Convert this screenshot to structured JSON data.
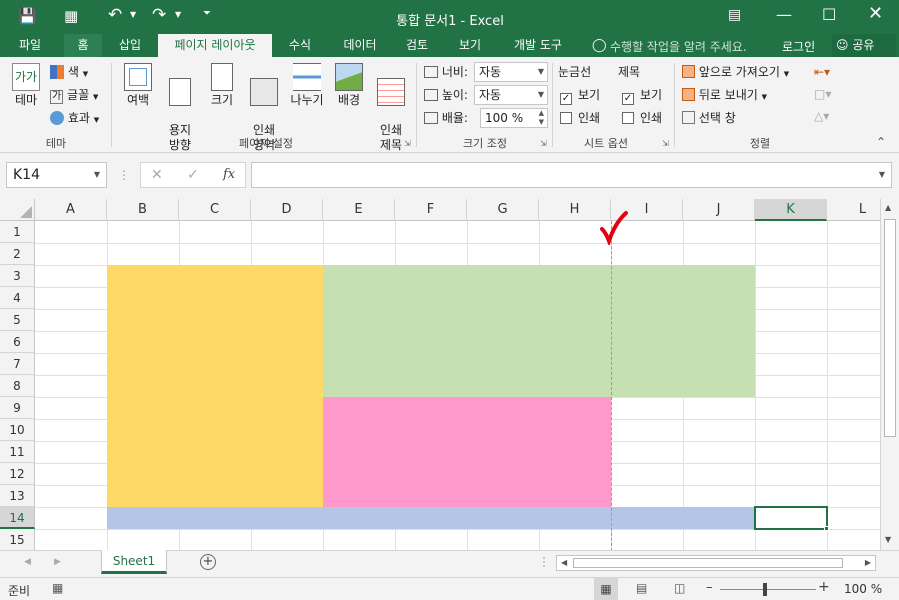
{
  "window": {
    "title": "통합 문서1 - Excel"
  },
  "tabs": [
    "파일",
    "홈",
    "삽입",
    "페이지 레이아웃",
    "수식",
    "데이터",
    "검토",
    "보기",
    "개발 도구"
  ],
  "active_tab": "페이지 레이아웃",
  "tell_me": "수행할 작업을 알려 주세요.",
  "account": {
    "login": "로그인",
    "share": "공유"
  },
  "ribbon": {
    "theme": {
      "label": "테마",
      "colors": "색",
      "fonts": "글꼴",
      "effects": "효과",
      "group": "테마"
    },
    "page_setup": {
      "margins": "여백",
      "orientation": "용지\n방향",
      "size": "크기",
      "print_area": "인쇄\n영역",
      "breaks": "나누기",
      "background": "배경",
      "print_titles": "인쇄\n제목",
      "group": "페이지 설정"
    },
    "scale": {
      "width_label": "너비:",
      "width_value": "자동",
      "height_label": "높이:",
      "height_value": "자동",
      "scale_label": "배율:",
      "scale_value": "100 %",
      "group": "크기 조정"
    },
    "sheet_options": {
      "gridlines": "눈금선",
      "headings": "제목",
      "view": "보기",
      "print": "인쇄",
      "group": "시트 옵션"
    },
    "arrange": {
      "bring_forward": "앞으로 가져오기",
      "send_backward": "뒤로 보내기",
      "selection_pane": "선택 창",
      "group": "정렬"
    }
  },
  "name_box": "K14",
  "formula": "",
  "columns": [
    "A",
    "B",
    "C",
    "D",
    "E",
    "F",
    "G",
    "H",
    "I",
    "J",
    "K",
    "L"
  ],
  "rows": [
    "1",
    "2",
    "3",
    "4",
    "5",
    "6",
    "7",
    "8",
    "9",
    "10",
    "11",
    "12",
    "13",
    "14",
    "15"
  ],
  "selected_cell": "K14",
  "fill_colors": {
    "yellow": "#ffd966",
    "green": "#c6e0b4",
    "pink": "#ff99cc",
    "blue": "#b4c6e7"
  },
  "sheet_tab": "Sheet1",
  "status": {
    "ready": "준비",
    "zoom": "100 %"
  }
}
